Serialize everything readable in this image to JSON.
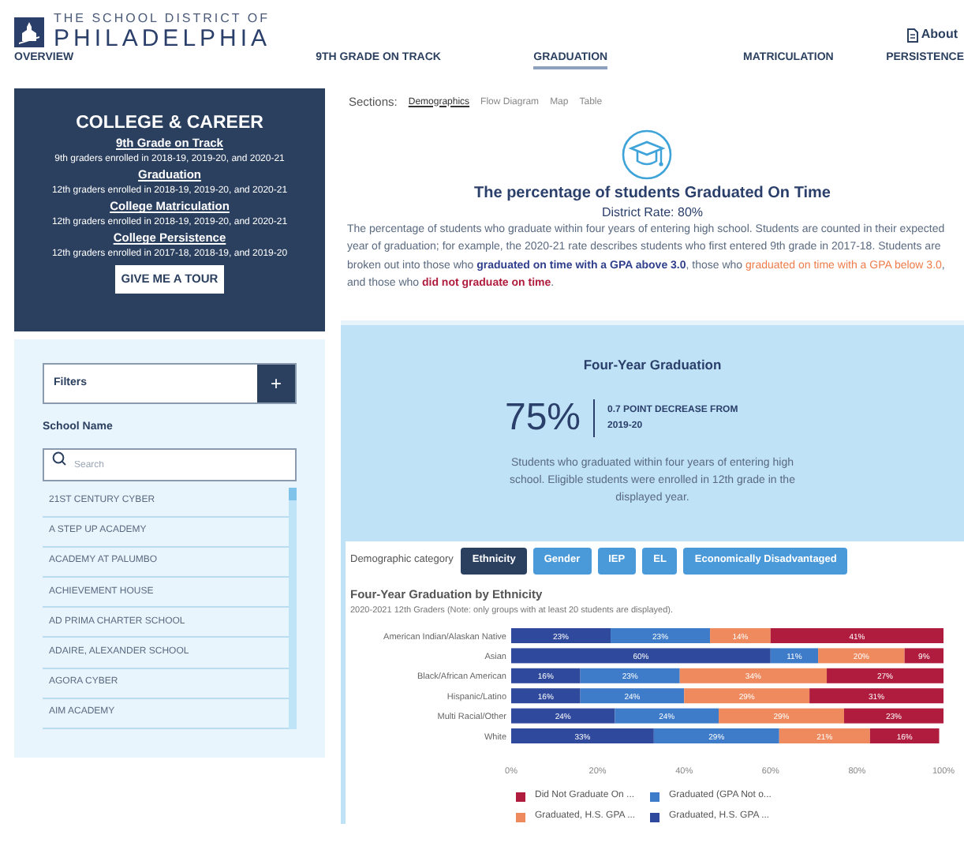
{
  "header": {
    "logo_line1": "THE SCHOOL DISTRICT OF",
    "logo_line2": "PHILADELPHIA",
    "about": "About"
  },
  "nav": [
    {
      "label": "OVERVIEW",
      "selected": false
    },
    {
      "label": "9TH GRADE ON TRACK",
      "selected": false
    },
    {
      "label": "GRADUATION",
      "selected": true
    },
    {
      "label": "MATRICULATION",
      "selected": false
    },
    {
      "label": "PERSISTENCE",
      "selected": false
    }
  ],
  "intro_card": {
    "title": "COLLEGE & CAREER",
    "items": [
      {
        "link": "9th Grade on Track",
        "note": "9th graders enrolled in 2018-19, 2019-20, and 2020-21"
      },
      {
        "link": "Graduation",
        "note": "12th graders enrolled in 2018-19, 2019-20, and 2020-21"
      },
      {
        "link": "College Matriculation",
        "note": "12th graders enrolled in 2018-19, 2019-20, and 2020-21"
      },
      {
        "link": "College Persistence",
        "note": "12th graders enrolled in 2017-18, 2018-19, and 2019-20"
      }
    ],
    "button": "GIVE ME A TOUR"
  },
  "filters": {
    "label": "Filters",
    "add": "+",
    "school_label": "School Name",
    "search_placeholder": "Search",
    "schools": [
      "21ST CENTURY CYBER",
      "A STEP UP ACADEMY",
      "ACADEMY AT PALUMBO",
      "ACHIEVEMENT HOUSE",
      "AD PRIMA CHARTER SCHOOL",
      "ADAIRE, ALEXANDER SCHOOL",
      "AGORA CYBER",
      "AIM ACADEMY"
    ]
  },
  "sections": {
    "label": "Sections:",
    "tabs": [
      {
        "label": "Demographics",
        "selected": true
      },
      {
        "label": "Flow Diagram",
        "selected": false
      },
      {
        "label": "Map",
        "selected": false
      },
      {
        "label": "Table",
        "selected": false
      }
    ]
  },
  "summary": {
    "title": "The percentage of students Graduated On Time",
    "district_rate": "District Rate: 80%",
    "description": [
      {
        "text": "The percentage of students who graduate within four years of entering high school. Students are counted in their expected year of graduation; for example, the 2020-21 rate describes students who first entered 9th grade in 2017-18. Students are broken out into those who "
      },
      {
        "text": "**graduated on time with a GPA above 3.0**",
        "color": "#2f3f8c"
      },
      {
        "text": ", those who "
      },
      {
        "text": "graduated on time with a GPA below 3.0",
        "color": "#ef7c4a"
      },
      {
        "text": ", and those who "
      },
      {
        "text": "**did not graduate on time**",
        "color": "#b01c3e"
      },
      {
        "text": "."
      }
    ]
  },
  "metric_card": {
    "title": "Four-Year Graduation",
    "value": "75%",
    "change": "0.7 POINT DECREASE FROM 2019-20",
    "description": "Students who graduated within four years of entering high school. Eligible students were enrolled in 12th grade in the displayed year."
  },
  "demographic": {
    "label": "Demographic category",
    "options": [
      {
        "label": "Ethnicity",
        "selected": true
      },
      {
        "label": "Gender",
        "selected": false
      },
      {
        "label": "IEP",
        "selected": false
      },
      {
        "label": "EL",
        "selected": false
      },
      {
        "label": "Economically Disadvantaged",
        "selected": false
      }
    ]
  },
  "chart": {
    "subtitle": "2020-2021 12th Graders (Note: only groups with at least 20 students are displayed).",
    "chart_data": {
      "type": "bar",
      "orientation": "horizontal",
      "stacked": true,
      "title": "Four-Year Graduation by Ethnicity",
      "categories": [
        "American Indian/Alaskan Native",
        "Asian",
        "Black/African American",
        "Hispanic/Latino",
        "Multi Racial/Other",
        "White"
      ],
      "series": [
        {
          "name": "Graduated, H.S. GPA ...",
          "color": "#2f4a9c",
          "values": [
            23,
            60,
            16,
            16,
            24,
            33
          ]
        },
        {
          "name": "Graduated (GPA Not o...",
          "color": "#3e7cc9",
          "values": [
            23,
            11,
            23,
            24,
            24,
            29
          ]
        },
        {
          "name": "Graduated, H.S. GPA ...",
          "color": "#ee8a5e",
          "values": [
            14,
            20,
            34,
            29,
            29,
            21
          ]
        },
        {
          "name": "Did Not Graduate On ...",
          "color": "#b01c3e",
          "values": [
            40,
            9,
            27,
            31,
            23,
            16
          ]
        }
      ],
      "value_labels": [
        [
          "23%",
          "60%",
          "16%",
          "16%",
          "24%",
          "33%"
        ],
        [
          "23%",
          "11%",
          "23%",
          "24%",
          "24%",
          "29%"
        ],
        [
          "14%",
          "20%",
          "34%",
          "29%",
          "29%",
          "21%"
        ],
        [
          "41%",
          "9%",
          "27%",
          "31%",
          "23%",
          "16%"
        ]
      ],
      "xlim": [
        0,
        100
      ],
      "xticks": [
        {
          "value": 0,
          "label": "0%"
        },
        {
          "value": 20,
          "label": "20%"
        },
        {
          "value": 40,
          "label": "40%"
        },
        {
          "value": 60,
          "label": "60%"
        },
        {
          "value": 80,
          "label": "80%"
        },
        {
          "value": 100,
          "label": "100%"
        }
      ]
    }
  }
}
